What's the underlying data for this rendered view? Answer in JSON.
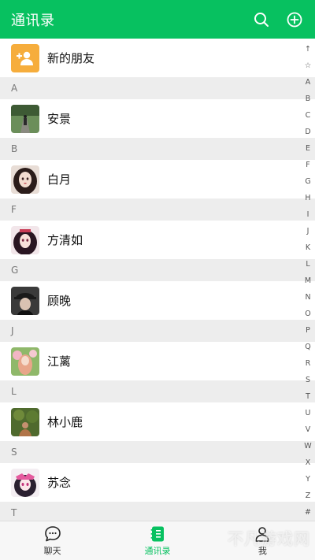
{
  "header": {
    "title": "通讯录"
  },
  "new_friend": {
    "label": "新的朋友"
  },
  "contacts": [
    {
      "letter": "A",
      "name": "安景"
    },
    {
      "letter": "B",
      "name": "白月"
    },
    {
      "letter": "F",
      "name": "方清如"
    },
    {
      "letter": "G",
      "name": "顾晚"
    },
    {
      "letter": "J",
      "name": "江蓠"
    },
    {
      "letter": "L",
      "name": "林小鹿"
    },
    {
      "letter": "S",
      "name": "苏念"
    },
    {
      "letter": "T"
    }
  ],
  "index_bar": [
    "↑",
    "☆",
    "A",
    "B",
    "C",
    "D",
    "E",
    "F",
    "G",
    "H",
    "I",
    "J",
    "K",
    "L",
    "M",
    "N",
    "O",
    "P",
    "Q",
    "R",
    "S",
    "T",
    "U",
    "V",
    "W",
    "X",
    "Y",
    "Z",
    "#"
  ],
  "tabs": [
    {
      "label": "聊天"
    },
    {
      "label": "通讯录"
    },
    {
      "label": "我"
    }
  ],
  "watermark": "不凡游戏网",
  "colors": {
    "accent": "#07c160",
    "new_friend_icon_bg": "#f6ad3c"
  }
}
